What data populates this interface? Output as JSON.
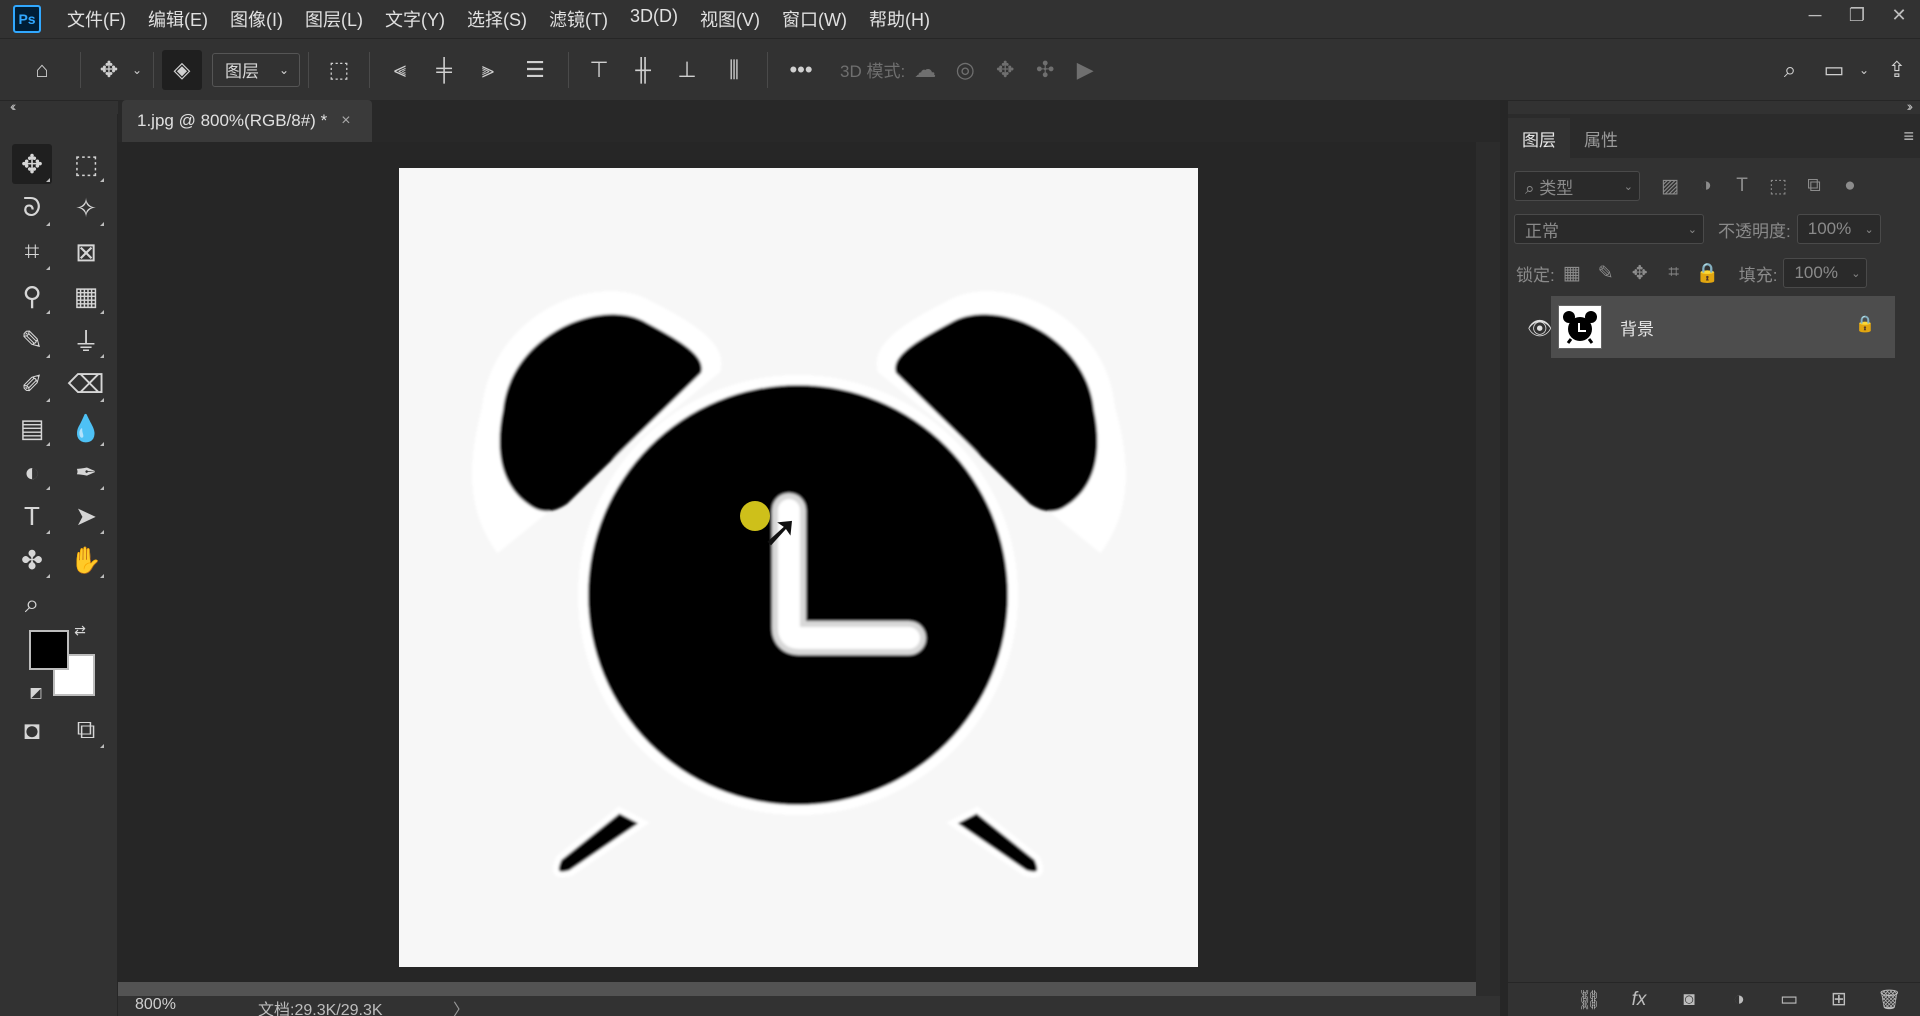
{
  "app": {
    "logo": "Ps"
  },
  "menu": [
    "文件(F)",
    "编辑(E)",
    "图像(I)",
    "图层(L)",
    "文字(Y)",
    "选择(S)",
    "滤镜(T)",
    "3D(D)",
    "视图(V)",
    "窗口(W)",
    "帮助(H)"
  ],
  "options": {
    "auto_select_target": "图层",
    "mode_label": "3D 模式:"
  },
  "document": {
    "tab_title": "1.jpg @ 800%(RGB/8#) *",
    "close_glyph": "×"
  },
  "status": {
    "zoom": "800%",
    "doc_size": "文档:29.3K/29.3K",
    "arrow": "〉"
  },
  "panel": {
    "tabs": [
      "图层",
      "属性"
    ],
    "filter_kind": "类型",
    "blend_mode": "正常",
    "opacity_label": "不透明度:",
    "opacity_value": "100%",
    "lock_label": "锁定:",
    "fill_label": "填充:",
    "fill_value": "100%"
  },
  "layers": [
    {
      "name": "背景",
      "visible": true,
      "locked": true
    }
  ],
  "colors": {
    "foreground": "#000000",
    "background": "#ffffff",
    "accent": "#31a8ff",
    "cursor_highlight": "#f2e21e"
  }
}
